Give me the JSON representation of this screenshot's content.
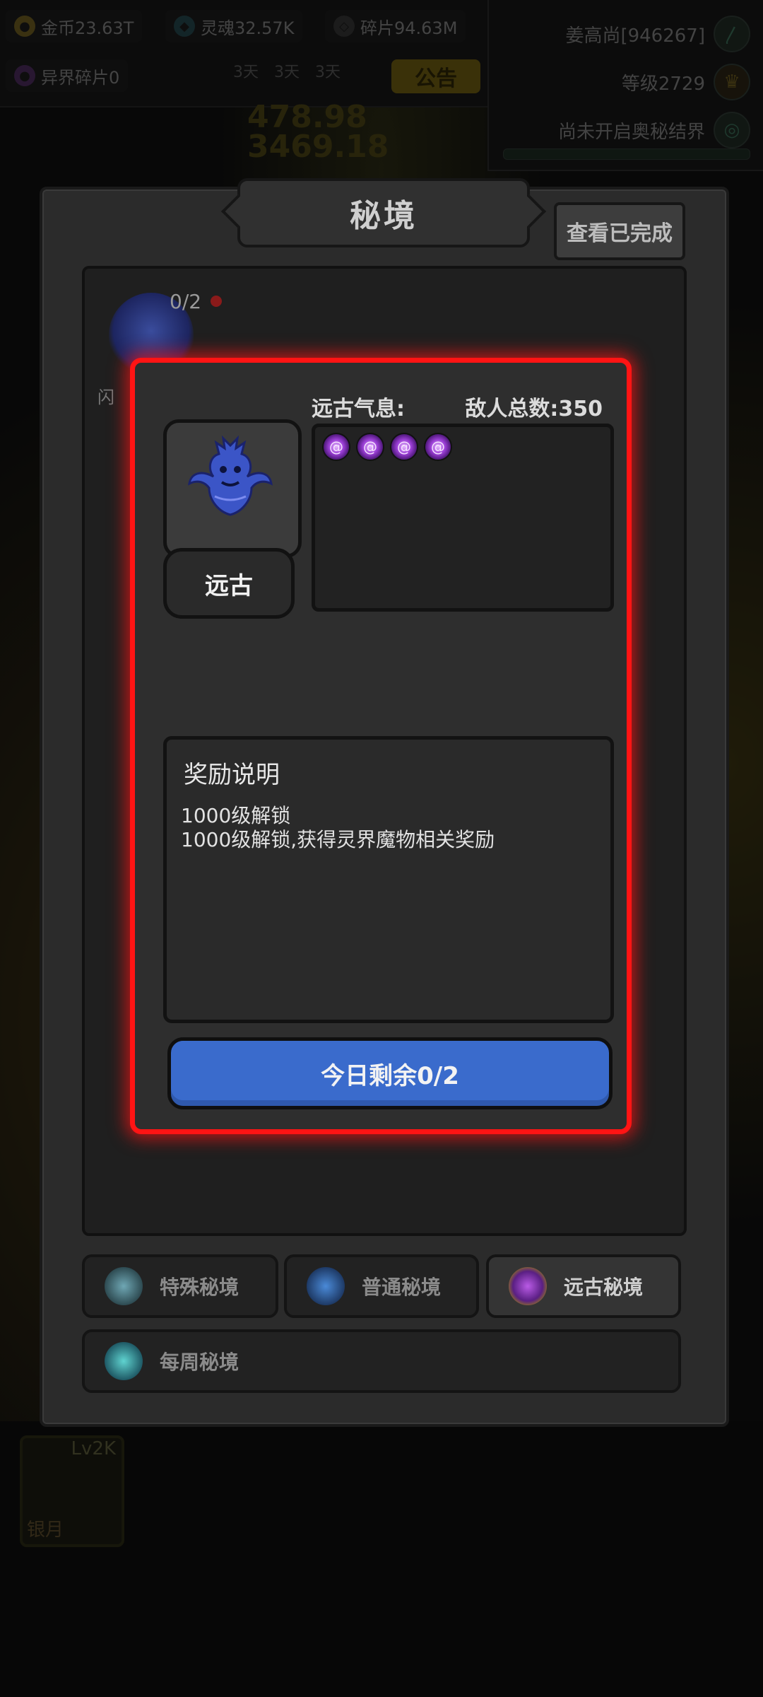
{
  "topbar": {
    "gold": "金币23.63T",
    "soul": "灵魂32.57K",
    "shards": "碎片94.63M",
    "otherworld_shards": "异界碎片0",
    "timers": [
      "3天",
      "3天",
      "3天"
    ],
    "notice_label": "公告",
    "bg_numbers": [
      "478.98",
      "3469.18"
    ]
  },
  "player": {
    "name": "姜高尚[946267]",
    "level": "等级2729",
    "realm_status": "尚未开启奥秘结界"
  },
  "dialog": {
    "title": "秘境",
    "view_completed_label": "查看已完成",
    "dungeon_card": {
      "count": "0/2",
      "caption": "闪"
    }
  },
  "popup": {
    "aura_label": "远古气息:",
    "enemy_total": "敌人总数:350",
    "monster_type": "远古",
    "aura_count": 4,
    "reward_title": "奖励说明",
    "reward_lines": [
      "1000级解锁",
      "1000级解锁,获得灵界魔物相关奖励"
    ],
    "start_button_label": "今日剩余0/2"
  },
  "tabs": [
    {
      "label": "特殊秘境",
      "active": false
    },
    {
      "label": "普通秘境",
      "active": false
    },
    {
      "label": "远古秘境",
      "active": true
    },
    {
      "label": "每周秘境",
      "active": false
    }
  ],
  "bottom": {
    "skill_level": "Lv2K",
    "skill_name": "银月"
  },
  "colors": {
    "highlight": "#ff1414",
    "button_blue": "#3a6bcc",
    "aura_purple": "#9b3fd6"
  }
}
